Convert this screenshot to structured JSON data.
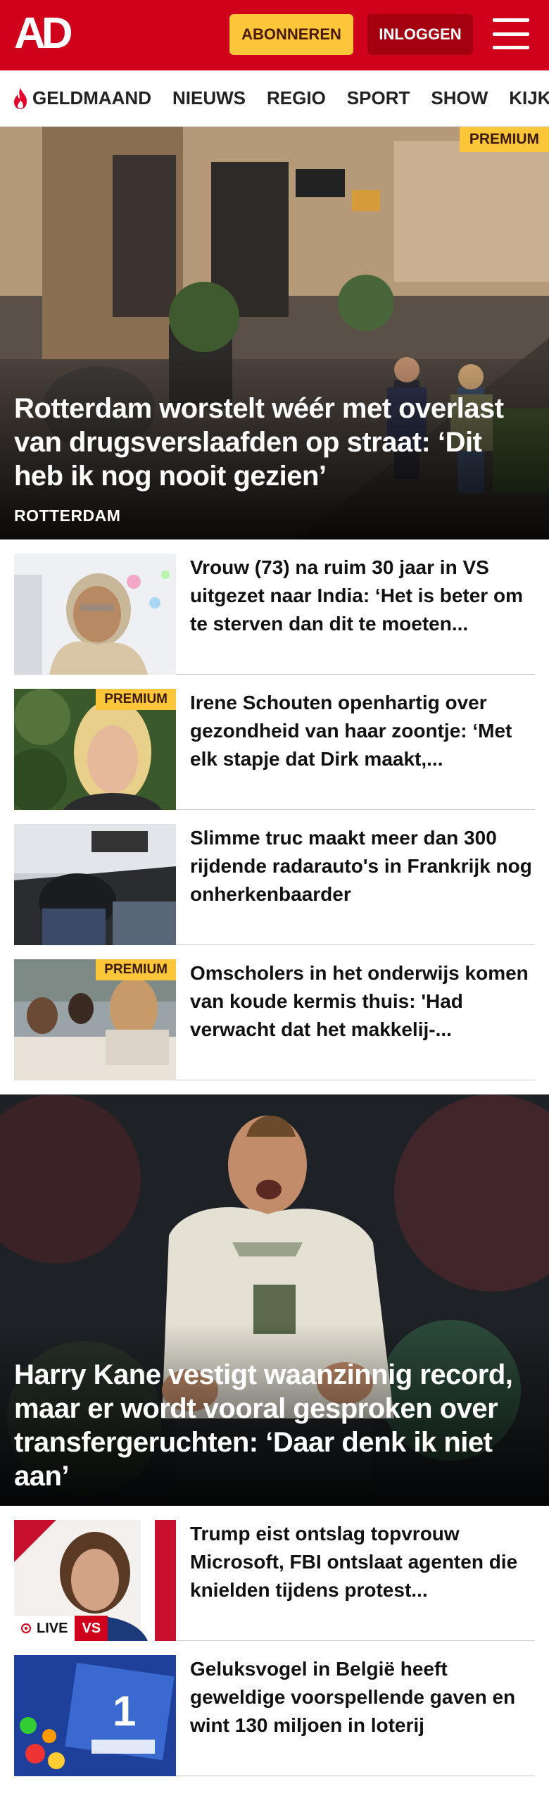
{
  "header": {
    "logo": "AD",
    "subscribe_label": "ABONNEREN",
    "login_label": "INLOGGEN"
  },
  "nav": {
    "items": [
      {
        "label": "GELDMAAND",
        "icon": "flame-icon"
      },
      {
        "label": "NIEUWS"
      },
      {
        "label": "REGIO"
      },
      {
        "label": "SPORT"
      },
      {
        "label": "SHOW"
      },
      {
        "label": "KIJK"
      }
    ]
  },
  "hero": {
    "badge": "PREMIUM",
    "title": "Rotterdam worstelt wéér met overlast van drugsverslaafden op straat: ‘Dit heb ik nog nooit gezien’",
    "category": "ROTTERDAM"
  },
  "articles": [
    {
      "title": "Vrouw (73) na ruim 30 jaar in VS uitgezet naar India: ‘Het is beter om te sterven dan dit te moeten..."
    },
    {
      "title": "Irene Schouten openhartig over gezondheid van haar zoontje: ‘Met elk stapje dat Dirk maakt,...",
      "badge": "PREMIUM"
    },
    {
      "title": "Slimme truc maakt meer dan 300 rijdende radarauto's in Frankrijk nog onherkenbaarder"
    },
    {
      "title": "Omscholers in het onderwijs komen van koude kermis thuis: 'Had verwacht dat het makkelij-...",
      "badge": "PREMIUM"
    }
  ],
  "hero2": {
    "title": "Harry Kane vestigt waanzinnig record, maar er wordt vooral gesproken over transfergeruchten: ‘Daar denk ik niet aan’"
  },
  "articles2": [
    {
      "title": "Trump eist ontslag topvrouw Microsoft, FBI ontslaat agenten die knielden tijdens protest...",
      "live_label": "LIVE",
      "vs_label": "VS"
    },
    {
      "title": "Geluksvogel in België heeft geweldige voorspellende gaven en wint 130 miljoen in loterij"
    }
  ],
  "colors": {
    "brand_red": "#d0021b",
    "premium_yellow": "#fcc63b",
    "login_dark_red": "#a5000f"
  }
}
